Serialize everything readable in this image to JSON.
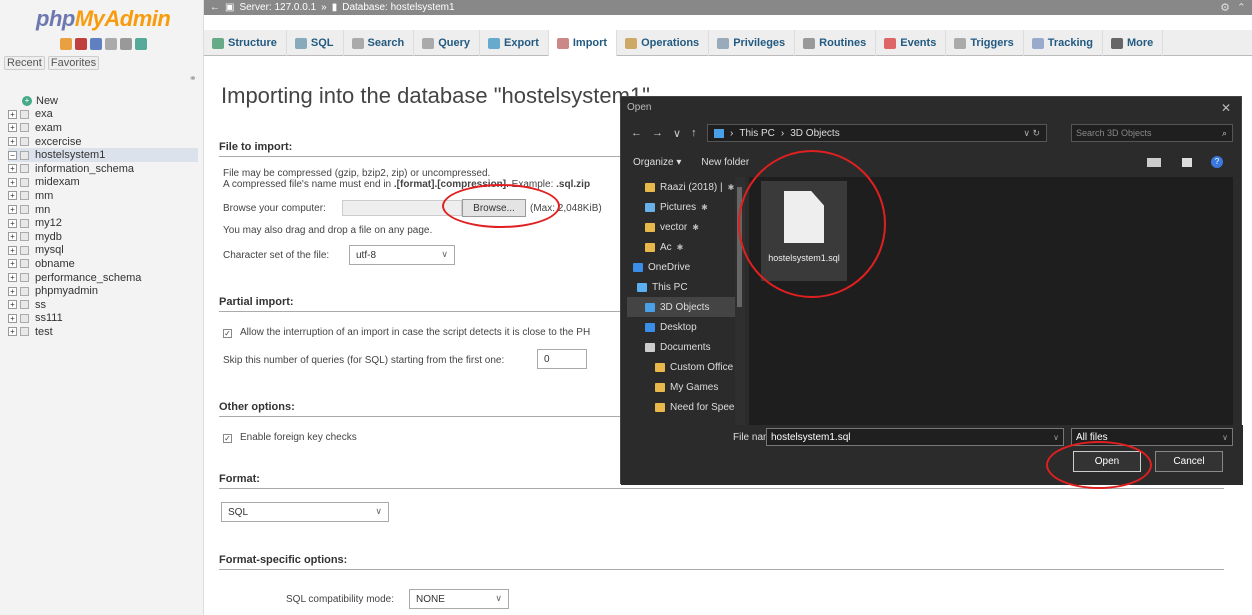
{
  "nav": {
    "logo_a": "php",
    "logo_b": "MyAdmin",
    "recent": "Recent",
    "favorites": "Favorites",
    "new_label": "New",
    "databases": [
      "exa",
      "exam",
      "excercise",
      "hostelsystem1",
      "information_schema",
      "midexam",
      "mm",
      "mn",
      "my12",
      "mydb",
      "mysql",
      "obname",
      "performance_schema",
      "phpmyadmin",
      "ss",
      "ss111",
      "test"
    ],
    "selected": "hostelsystem1"
  },
  "breadcrumb": {
    "server": "Server: 127.0.0.1",
    "sep": "»",
    "database": "Database: hostelsystem1"
  },
  "tabs": [
    {
      "label": "Structure",
      "color": "#6a8"
    },
    {
      "label": "SQL",
      "color": "#8ab"
    },
    {
      "label": "Search",
      "color": "#aaa"
    },
    {
      "label": "Query",
      "color": "#aaa"
    },
    {
      "label": "Export",
      "color": "#6ac"
    },
    {
      "label": "Import",
      "color": "#c88"
    },
    {
      "label": "Operations",
      "color": "#ca6"
    },
    {
      "label": "Privileges",
      "color": "#9ab"
    },
    {
      "label": "Routines",
      "color": "#999"
    },
    {
      "label": "Events",
      "color": "#d66"
    },
    {
      "label": "Triggers",
      "color": "#aaa"
    },
    {
      "label": "Tracking",
      "color": "#9ac"
    },
    {
      "label": "More",
      "color": "#666"
    }
  ],
  "main": {
    "title": "Importing into the database \"hostelsystem1\"",
    "file_to_import": "File to import:",
    "compress1": "File may be compressed (gzip, bzip2, zip) or uncompressed.",
    "compress2a": "A compressed file's name must end in ",
    "compress2b": ".[format].[compression]",
    "compress2c": ". Example: ",
    "compress2d": ".sql.zip",
    "browse_label": "Browse your computer:",
    "browse_btn": "Browse...",
    "max": "(Max: 2,048KiB)",
    "dragdrop": "You may also drag and drop a file on any page.",
    "charset_label": "Character set of the file:",
    "charset": "utf-8",
    "partial": "Partial import:",
    "interrupt": "Allow the interruption of an import in case the script detects it is close to the PH",
    "skip_label": "Skip this number of queries (for SQL) starting from the first one:",
    "skip_val": "0",
    "other": "Other options:",
    "fk": "Enable foreign key checks",
    "format": "Format:",
    "format_val": "SQL",
    "fso": "Format-specific options:",
    "compat_label": "SQL compatibility mode:",
    "compat_val": "NONE"
  },
  "dialog": {
    "title": "Open",
    "path_a": "This PC",
    "path_b": "3D Objects",
    "search_ph": "Search 3D Objects",
    "organize": "Organize ▾",
    "newfolder": "New folder",
    "tree": [
      {
        "label": "Raazi (2018) |",
        "color": "#e8b84a"
      },
      {
        "label": "Pictures",
        "color": "#6ab0e8"
      },
      {
        "label": "vector",
        "color": "#e8b84a"
      },
      {
        "label": "Ac",
        "color": "#e8b84a"
      },
      {
        "label": "OneDrive",
        "color": "#3a8ee8"
      },
      {
        "label": "This PC",
        "color": "#5ab0f0"
      },
      {
        "label": "3D Objects",
        "color": "#4aa0e8"
      },
      {
        "label": "Desktop",
        "color": "#3a8ee8"
      },
      {
        "label": "Documents",
        "color": "#ccc"
      },
      {
        "label": "Custom Office",
        "color": "#e8b84a"
      },
      {
        "label": "My Games",
        "color": "#e8b84a"
      },
      {
        "label": "Need for Speed",
        "color": "#e8b84a"
      }
    ],
    "file": "hostelsystem1.sql",
    "fn_label": "File name:",
    "fn_val": "hostelsystem1.sql",
    "filetype": "All files",
    "open": "Open",
    "cancel": "Cancel"
  }
}
